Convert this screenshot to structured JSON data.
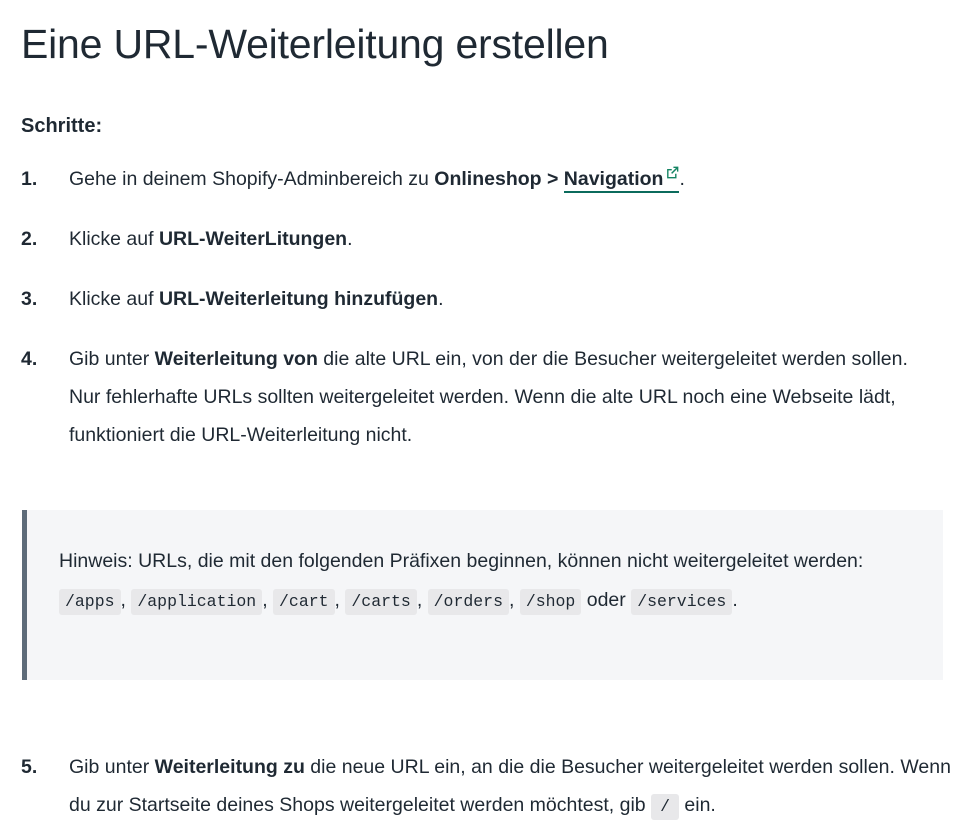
{
  "document": {
    "title": "Eine URL-Weiterleitung erstellen",
    "steps_heading": "Schritte:"
  },
  "steps": [
    {
      "number": "1.",
      "parts": [
        {
          "type": "text",
          "value": "Gehe in deinem Shopify-Adminbereich zu "
        },
        {
          "type": "bold",
          "value": "Onlineshop > "
        },
        {
          "type": "link",
          "value": "Navigation",
          "icon": "external-link-icon"
        },
        {
          "type": "text",
          "value": "."
        }
      ]
    },
    {
      "number": "2.",
      "parts": [
        {
          "type": "text",
          "value": "Klicke auf "
        },
        {
          "type": "bold",
          "value": "URL-WeiterLitungen"
        },
        {
          "type": "text",
          "value": "."
        }
      ]
    },
    {
      "number": "3.",
      "parts": [
        {
          "type": "text",
          "value": "Klicke auf "
        },
        {
          "type": "bold",
          "value": "URL-Weiterleitung hinzufügen"
        },
        {
          "type": "text",
          "value": "."
        }
      ]
    },
    {
      "number": "4.",
      "parts": [
        {
          "type": "text",
          "value": "Gib unter "
        },
        {
          "type": "bold",
          "value": "Weiterleitung von"
        },
        {
          "type": "text",
          "value": " die alte URL ein, von der die Besucher weitergeleitet werden sollen. Nur fehlerhafte URLs sollten weitergeleitet werden. Wenn die alte URL noch eine Webseite lädt, funktioniert die URL-Weiterleitung nicht."
        }
      ]
    }
  ],
  "note": {
    "intro": "Hinweis: URLs, die mit den folgenden Präfixen beginnen, können nicht weitergeleitet werden: ",
    "prefixes": [
      "/apps",
      "/application",
      "/cart",
      "/carts",
      "/orders",
      "/shop"
    ],
    "separator": ", ",
    "conjunction": " oder ",
    "last_prefix": "/services",
    "end": "."
  },
  "final_step": {
    "number": "5.",
    "lead": "Gib unter ",
    "bold": "Weiterleitung zu",
    "middle": " die neue URL ein, an die die Besucher weitergeleitet werden sollen. Wenn du zur Startseite deines Shops weitergeleitet werden möchtest, gib ",
    "code": "/",
    "tail": " ein."
  },
  "colors": {
    "text": "#1f2933",
    "link_underline": "#0b6b5c",
    "icon_green": "#158463",
    "note_background": "#f5f6f8",
    "note_border": "#5d6b79",
    "chip_background": "#e8e8ea"
  },
  "icons": {
    "external_link": "external-link-icon"
  }
}
